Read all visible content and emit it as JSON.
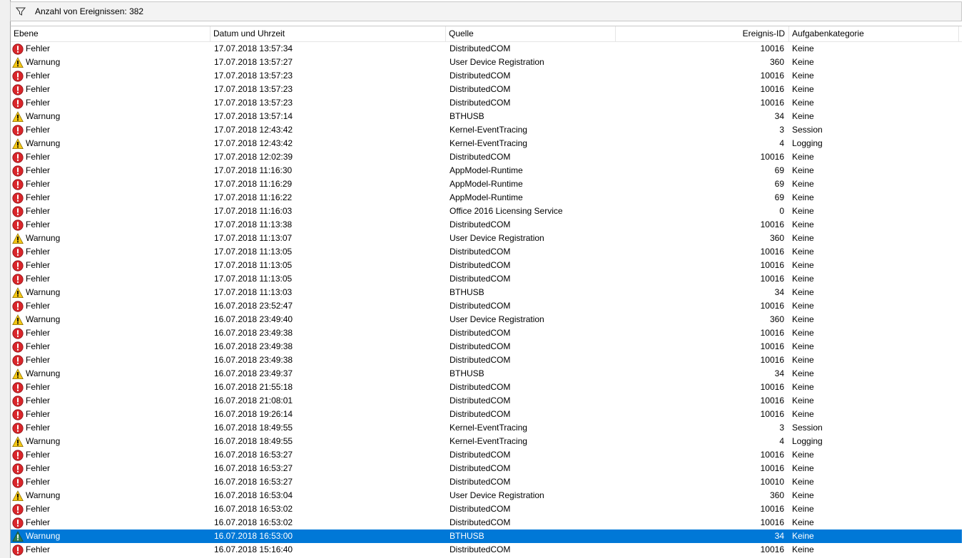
{
  "filter": {
    "icon": "filter-icon",
    "count_text": "Anzahl von Ereignissen: 382"
  },
  "columns": {
    "level": "Ebene",
    "date": "Datum und Uhrzeit",
    "source": "Quelle",
    "id": "Ereignis-ID",
    "category": "Aufgabenkategorie"
  },
  "colors": {
    "error": "#d9262b",
    "warning": "#f6c815",
    "selection": "#0078d7"
  },
  "rows": [
    {
      "level": "Fehler",
      "type": "error",
      "date": "17.07.2018 13:57:34",
      "source": "DistributedCOM",
      "id": "10016",
      "category": "Keine"
    },
    {
      "level": "Warnung",
      "type": "warning",
      "date": "17.07.2018 13:57:27",
      "source": "User Device Registration",
      "id": "360",
      "category": "Keine"
    },
    {
      "level": "Fehler",
      "type": "error",
      "date": "17.07.2018 13:57:23",
      "source": "DistributedCOM",
      "id": "10016",
      "category": "Keine"
    },
    {
      "level": "Fehler",
      "type": "error",
      "date": "17.07.2018 13:57:23",
      "source": "DistributedCOM",
      "id": "10016",
      "category": "Keine"
    },
    {
      "level": "Fehler",
      "type": "error",
      "date": "17.07.2018 13:57:23",
      "source": "DistributedCOM",
      "id": "10016",
      "category": "Keine"
    },
    {
      "level": "Warnung",
      "type": "warning",
      "date": "17.07.2018 13:57:14",
      "source": "BTHUSB",
      "id": "34",
      "category": "Keine"
    },
    {
      "level": "Fehler",
      "type": "error",
      "date": "17.07.2018 12:43:42",
      "source": "Kernel-EventTracing",
      "id": "3",
      "category": "Session"
    },
    {
      "level": "Warnung",
      "type": "warning",
      "date": "17.07.2018 12:43:42",
      "source": "Kernel-EventTracing",
      "id": "4",
      "category": "Logging"
    },
    {
      "level": "Fehler",
      "type": "error",
      "date": "17.07.2018 12:02:39",
      "source": "DistributedCOM",
      "id": "10016",
      "category": "Keine"
    },
    {
      "level": "Fehler",
      "type": "error",
      "date": "17.07.2018 11:16:30",
      "source": "AppModel-Runtime",
      "id": "69",
      "category": "Keine"
    },
    {
      "level": "Fehler",
      "type": "error",
      "date": "17.07.2018 11:16:29",
      "source": "AppModel-Runtime",
      "id": "69",
      "category": "Keine"
    },
    {
      "level": "Fehler",
      "type": "error",
      "date": "17.07.2018 11:16:22",
      "source": "AppModel-Runtime",
      "id": "69",
      "category": "Keine"
    },
    {
      "level": "Fehler",
      "type": "error",
      "date": "17.07.2018 11:16:03",
      "source": "Office 2016 Licensing Service",
      "id": "0",
      "category": "Keine"
    },
    {
      "level": "Fehler",
      "type": "error",
      "date": "17.07.2018 11:13:38",
      "source": "DistributedCOM",
      "id": "10016",
      "category": "Keine"
    },
    {
      "level": "Warnung",
      "type": "warning",
      "date": "17.07.2018 11:13:07",
      "source": "User Device Registration",
      "id": "360",
      "category": "Keine"
    },
    {
      "level": "Fehler",
      "type": "error",
      "date": "17.07.2018 11:13:05",
      "source": "DistributedCOM",
      "id": "10016",
      "category": "Keine"
    },
    {
      "level": "Fehler",
      "type": "error",
      "date": "17.07.2018 11:13:05",
      "source": "DistributedCOM",
      "id": "10016",
      "category": "Keine"
    },
    {
      "level": "Fehler",
      "type": "error",
      "date": "17.07.2018 11:13:05",
      "source": "DistributedCOM",
      "id": "10016",
      "category": "Keine"
    },
    {
      "level": "Warnung",
      "type": "warning",
      "date": "17.07.2018 11:13:03",
      "source": "BTHUSB",
      "id": "34",
      "category": "Keine"
    },
    {
      "level": "Fehler",
      "type": "error",
      "date": "16.07.2018 23:52:47",
      "source": "DistributedCOM",
      "id": "10016",
      "category": "Keine"
    },
    {
      "level": "Warnung",
      "type": "warning",
      "date": "16.07.2018 23:49:40",
      "source": "User Device Registration",
      "id": "360",
      "category": "Keine"
    },
    {
      "level": "Fehler",
      "type": "error",
      "date": "16.07.2018 23:49:38",
      "source": "DistributedCOM",
      "id": "10016",
      "category": "Keine"
    },
    {
      "level": "Fehler",
      "type": "error",
      "date": "16.07.2018 23:49:38",
      "source": "DistributedCOM",
      "id": "10016",
      "category": "Keine"
    },
    {
      "level": "Fehler",
      "type": "error",
      "date": "16.07.2018 23:49:38",
      "source": "DistributedCOM",
      "id": "10016",
      "category": "Keine"
    },
    {
      "level": "Warnung",
      "type": "warning",
      "date": "16.07.2018 23:49:37",
      "source": "BTHUSB",
      "id": "34",
      "category": "Keine"
    },
    {
      "level": "Fehler",
      "type": "error",
      "date": "16.07.2018 21:55:18",
      "source": "DistributedCOM",
      "id": "10016",
      "category": "Keine"
    },
    {
      "level": "Fehler",
      "type": "error",
      "date": "16.07.2018 21:08:01",
      "source": "DistributedCOM",
      "id": "10016",
      "category": "Keine"
    },
    {
      "level": "Fehler",
      "type": "error",
      "date": "16.07.2018 19:26:14",
      "source": "DistributedCOM",
      "id": "10016",
      "category": "Keine"
    },
    {
      "level": "Fehler",
      "type": "error",
      "date": "16.07.2018 18:49:55",
      "source": "Kernel-EventTracing",
      "id": "3",
      "category": "Session"
    },
    {
      "level": "Warnung",
      "type": "warning",
      "date": "16.07.2018 18:49:55",
      "source": "Kernel-EventTracing",
      "id": "4",
      "category": "Logging"
    },
    {
      "level": "Fehler",
      "type": "error",
      "date": "16.07.2018 16:53:27",
      "source": "DistributedCOM",
      "id": "10016",
      "category": "Keine"
    },
    {
      "level": "Fehler",
      "type": "error",
      "date": "16.07.2018 16:53:27",
      "source": "DistributedCOM",
      "id": "10016",
      "category": "Keine"
    },
    {
      "level": "Fehler",
      "type": "error",
      "date": "16.07.2018 16:53:27",
      "source": "DistributedCOM",
      "id": "10010",
      "category": "Keine"
    },
    {
      "level": "Warnung",
      "type": "warning",
      "date": "16.07.2018 16:53:04",
      "source": "User Device Registration",
      "id": "360",
      "category": "Keine"
    },
    {
      "level": "Fehler",
      "type": "error",
      "date": "16.07.2018 16:53:02",
      "source": "DistributedCOM",
      "id": "10016",
      "category": "Keine"
    },
    {
      "level": "Fehler",
      "type": "error",
      "date": "16.07.2018 16:53:02",
      "source": "DistributedCOM",
      "id": "10016",
      "category": "Keine"
    },
    {
      "level": "Warnung",
      "type": "warning",
      "date": "16.07.2018 16:53:00",
      "source": "BTHUSB",
      "id": "34",
      "category": "Keine",
      "selected": true
    },
    {
      "level": "Fehler",
      "type": "error",
      "date": "16.07.2018 15:16:40",
      "source": "DistributedCOM",
      "id": "10016",
      "category": "Keine"
    }
  ]
}
